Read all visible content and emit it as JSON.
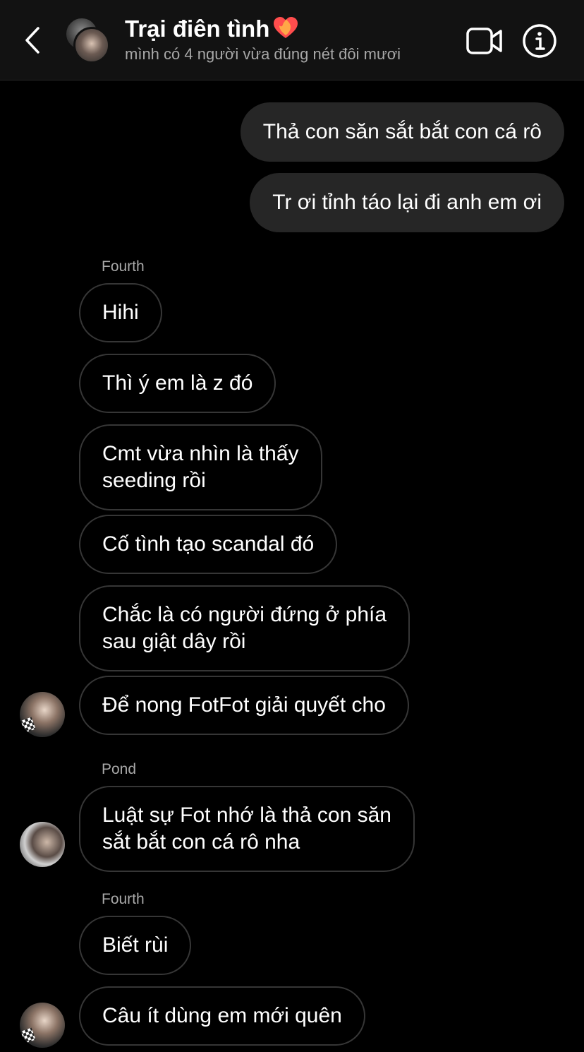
{
  "header": {
    "title": "Trại điên tình",
    "subtitle": "mình có 4 người vừa đúng nét đôi mươi",
    "heart_color": "#ff4d4d"
  },
  "messages": {
    "outgoing": [
      "Thả con săn sắt bắt con cá rô",
      "Tr ơi tỉnh táo lại đi anh em ơi"
    ],
    "group1": {
      "sender": "Fourth",
      "items": [
        "Hihi",
        "Thì ý em là z đó",
        [
          "Cmt vừa nhìn là thấy",
          "seeding rồi"
        ],
        "Cố tình tạo scandal đó",
        [
          "Chắc là có người đứng ở phía",
          "sau giật dây rồi"
        ],
        "Để nong FotFot giải quyết cho"
      ]
    },
    "group2": {
      "sender": "Pond",
      "items": [
        [
          "Luật sự Fot nhớ là thả con săn",
          "sắt bắt con cá rô nha"
        ]
      ]
    },
    "group3": {
      "sender": "Fourth",
      "items": [
        "Biết rùi",
        "Câu ít dùng em mới quên"
      ]
    }
  }
}
